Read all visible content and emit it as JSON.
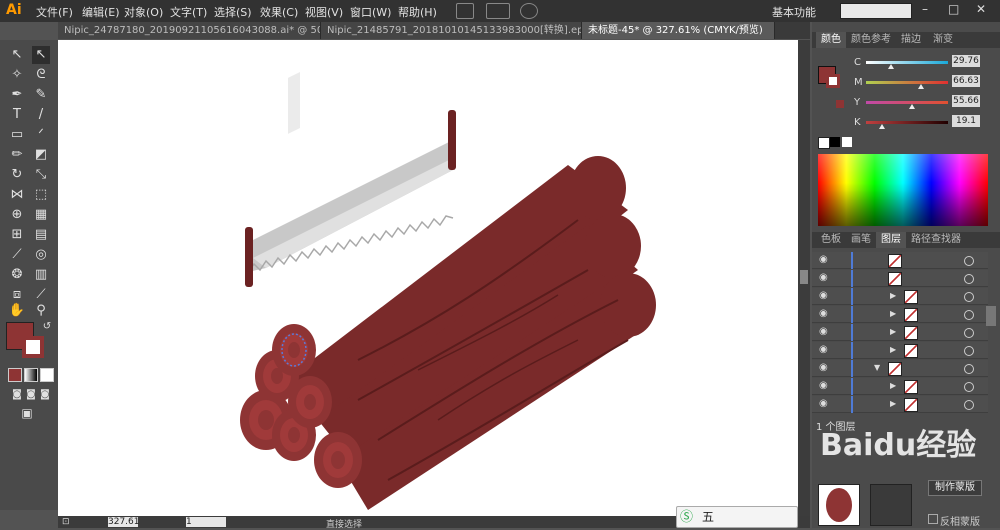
{
  "app": {
    "logo": "Ai"
  },
  "menu": [
    "文件(F)",
    "编辑(E)",
    "对象(O)",
    "文字(T)",
    "选择(S)",
    "效果(C)",
    "视图(V)",
    "窗口(W)",
    "帮助(H)"
  ],
  "workspace_label": "基本功能",
  "tabs": [
    {
      "label": "Nipic_24787180_20190921105616043088.ai* @ 50...",
      "active": false
    },
    {
      "label": "Nipic_21485791_20181010145133983000[转换].eps*",
      "active": false
    },
    {
      "label": "未标题-45* @ 327.61% (CMYK/预览)",
      "active": true
    }
  ],
  "color_panel": {
    "tabs": [
      "颜色",
      "颜色参考",
      "描边",
      "渐变"
    ],
    "channels": [
      {
        "name": "C",
        "value": "29.76",
        "fraction": 0.3,
        "color": "#e85a5a"
      },
      {
        "name": "M",
        "value": "66.63",
        "fraction": 0.67,
        "color": "#e2d84a"
      },
      {
        "name": "Y",
        "value": "55.66",
        "fraction": 0.56,
        "color": "#c94aa8"
      },
      {
        "name": "K",
        "value": "19.1",
        "fraction": 0.19,
        "color": "#aa3535"
      }
    ]
  },
  "layers_panel": {
    "tabs": [
      "色板",
      "画笔",
      "图层",
      "路径查找器"
    ],
    "footer_count": "1 个图层"
  },
  "status": {
    "zoom": "327.61",
    "page": "1",
    "tool": "直接选择"
  },
  "bottom_panel": {
    "button": "制作蒙版",
    "option": "反相蒙版"
  },
  "ime": {
    "label": "五"
  },
  "watermark": "Baidu经验",
  "colors": {
    "fill": "#8e3434",
    "wood": "#7a2a2a",
    "wood_end": "#a03a3a",
    "saw_blade": "#c8c8c8",
    "saw_handle": "#6b2222",
    "accent_blue": "#5a7ad8"
  }
}
